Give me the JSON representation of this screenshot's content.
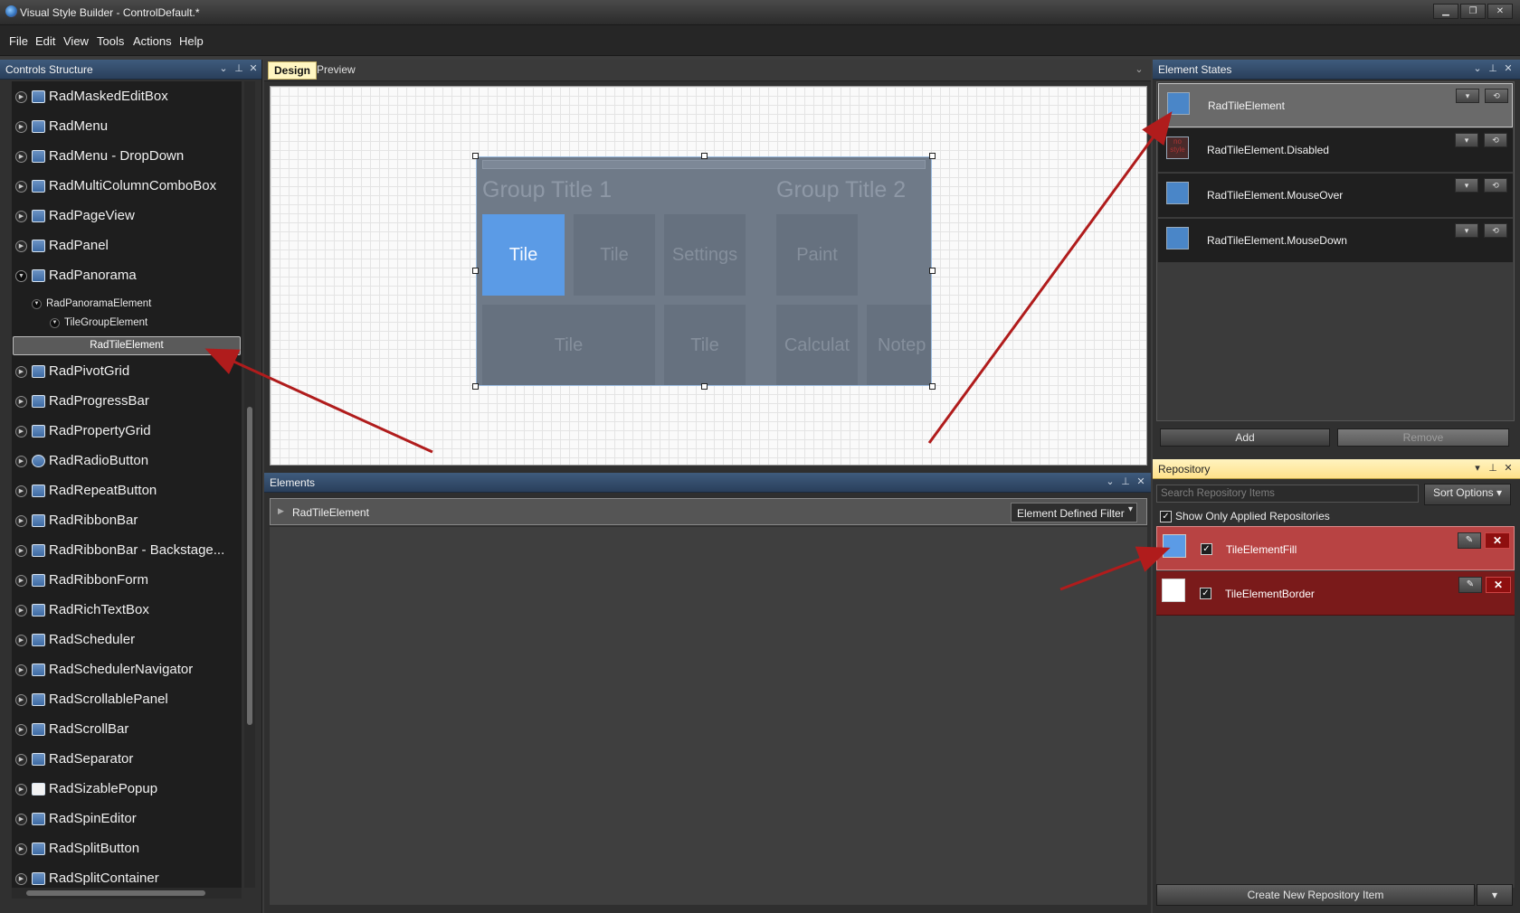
{
  "window": {
    "title": "Visual Style Builder - ControlDefault.*",
    "minimize": "▁",
    "maximize": "❐",
    "close": "✕"
  },
  "menu": [
    "File",
    "Edit",
    "View",
    "Tools",
    "Actions",
    "Help"
  ],
  "controls_structure": {
    "title": "Controls Structure",
    "items_above": [
      "RadMaskedEditBox",
      "RadMenu",
      "RadMenu - DropDown",
      "RadMultiColumnComboBox",
      "RadPageView",
      "RadPanel",
      "RadPanorama"
    ],
    "sub_items": [
      "RadPanoramaElement",
      "TileGroupElement"
    ],
    "selected": "RadTileElement",
    "items_below": [
      "RadPivotGrid",
      "RadProgressBar",
      "RadPropertyGrid",
      "RadRadioButton",
      "RadRepeatButton",
      "RadRibbonBar",
      "RadRibbonBar  -  Backstage...",
      "RadRibbonForm",
      "RadRichTextBox",
      "RadScheduler",
      "RadSchedulerNavigator",
      "RadScrollablePanel",
      "RadScrollBar",
      "RadSeparator",
      "RadSizablePopup",
      "RadSpinEditor",
      "RadSplitButton",
      "RadSplitContainer"
    ]
  },
  "tabs": {
    "design": "Design",
    "preview": "Preview"
  },
  "panorama": {
    "group1": "Group Title 1",
    "group2": "Group Title 2",
    "tiles": [
      "Tile",
      "Tile",
      "Settings",
      "Paint",
      "Tile",
      "Tile",
      "Calculat",
      "Notep"
    ]
  },
  "elements": {
    "title": "Elements",
    "row_label": "RadTileElement",
    "filter": "Element Defined Filter"
  },
  "element_states": {
    "title": "Element States",
    "states": [
      "RadTileElement",
      "RadTileElement.Disabled",
      "RadTileElement.MouseOver",
      "RadTileElement.MouseDown"
    ],
    "no_style_text": "no style",
    "add": "Add",
    "remove": "Remove"
  },
  "repository": {
    "title": "Repository",
    "search_placeholder": "Search Repository Items",
    "sort": "Sort Options",
    "show_applied": "Show Only Applied Repositories",
    "items": [
      {
        "name": "TileElementFill",
        "swatch": "#5b9be6"
      },
      {
        "name": "TileElementBorder",
        "swatch": "#ffffff"
      }
    ],
    "create": "Create New Repository Item"
  },
  "colors": {
    "accent": "#3f5b7d",
    "tile_active": "#5b9be6",
    "arrow": "#b01c1c",
    "repo_row": "#7a1a1a"
  }
}
